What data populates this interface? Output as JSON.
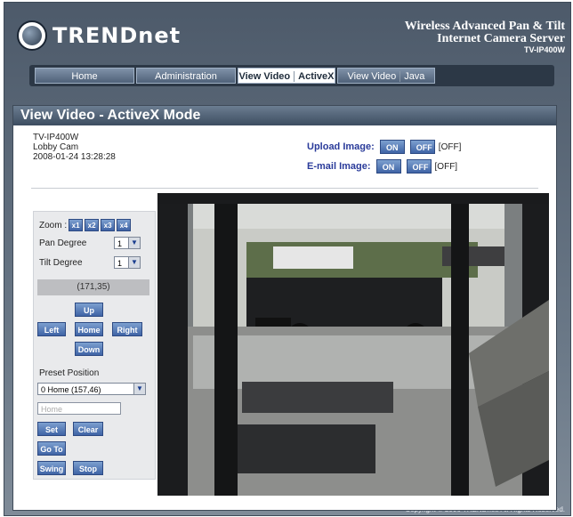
{
  "brand": {
    "name": "TRENDnet"
  },
  "product": {
    "line1": "Wireless Advanced Pan & Tilt",
    "line2": "Internet Camera Server",
    "model": "TV-IP400W"
  },
  "nav": {
    "home": "Home",
    "administration": "Administration",
    "view_video_label": "View Video",
    "activex": "ActiveX",
    "view_video_label2": "View Video",
    "java": "Java"
  },
  "page": {
    "title": "View Video - ActiveX Mode"
  },
  "camera": {
    "model": "TV-IP400W",
    "name": "Lobby Cam",
    "datetime": "2008-01-24 13:28:28"
  },
  "upload": {
    "label": "Upload Image:",
    "on": "ON",
    "off": "OFF",
    "state": "[OFF]"
  },
  "email": {
    "label": "E-mail Image:",
    "on": "ON",
    "off": "OFF",
    "state": "[OFF]"
  },
  "controls": {
    "zoom_label": "Zoom :",
    "zoom": [
      "x1",
      "x2",
      "x3",
      "x4"
    ],
    "pan_label": "Pan Degree",
    "pan_value": "1",
    "tilt_label": "Tilt Degree",
    "tilt_value": "1",
    "position": "(171,35)",
    "up": "Up",
    "left": "Left",
    "home": "Home",
    "right": "Right",
    "down": "Down",
    "preset_label": "Preset Position",
    "preset_value": "0 Home (157,46)",
    "preset_input_placeholder": "Home",
    "set": "Set",
    "clear": "Clear",
    "goto": "Go To",
    "swing": "Swing",
    "stop": "Stop"
  },
  "footer": {
    "copyright": "Copyright © 2006 TRENDnet. All Rights Reserved."
  }
}
